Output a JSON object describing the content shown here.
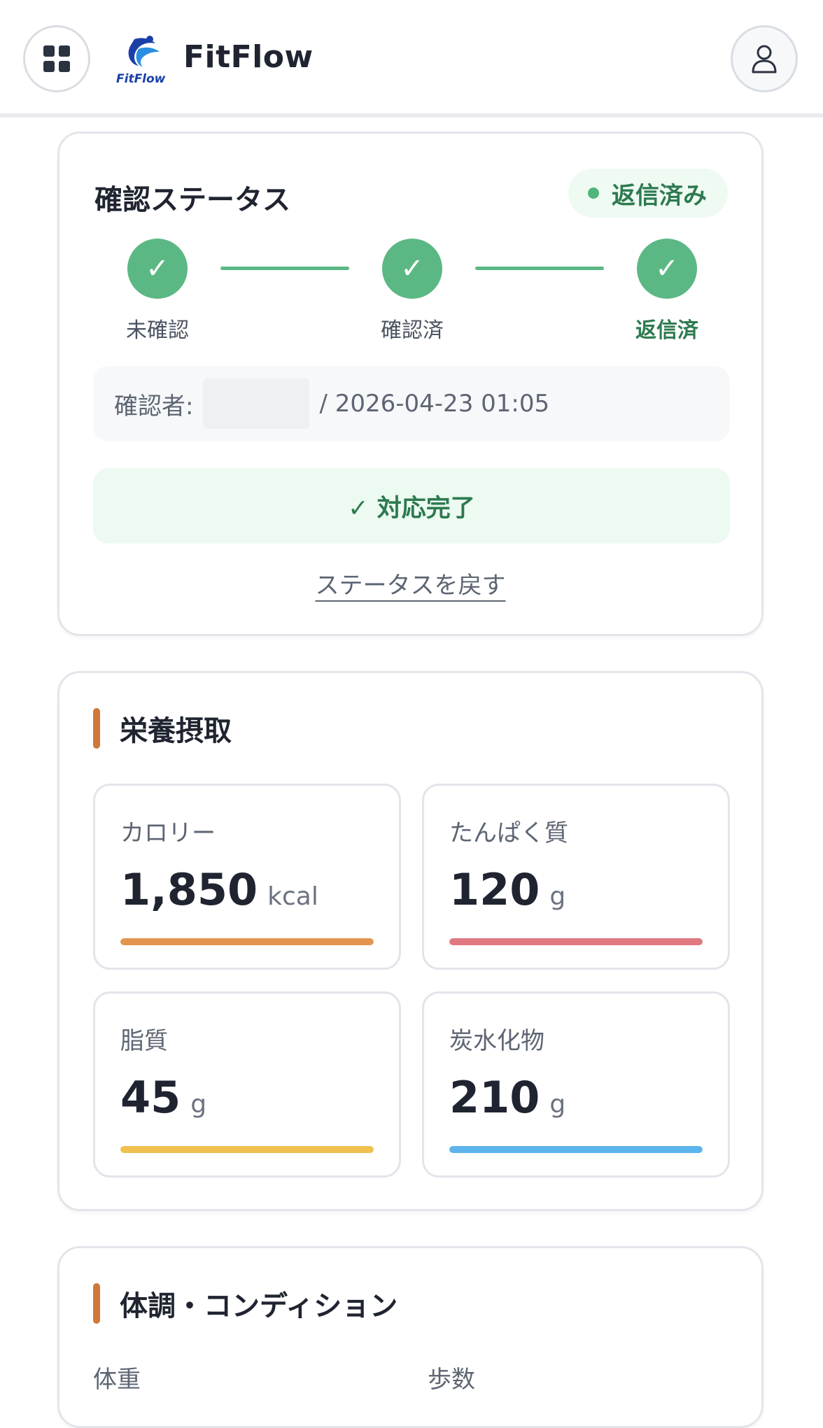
{
  "header": {
    "app_title": "FitFlow",
    "logo_text": "FitFlow"
  },
  "status": {
    "title": "確認ステータス",
    "badge": "返信済み",
    "steps": [
      {
        "label": "未確認",
        "mark": "✓"
      },
      {
        "label": "確認済",
        "mark": "✓"
      },
      {
        "label": "返信済",
        "mark": "✓"
      }
    ],
    "confirmer_label": "確認者:",
    "confirmer_time": "/ 2026-04-23 01:05",
    "done_button": "✓ 対応完了",
    "revert_link": "ステータスを戻す",
    "colors": {
      "accent": "#5bb884",
      "accent_dark": "#2d7a4f"
    }
  },
  "nutrition": {
    "title": "栄養摂取",
    "metrics": [
      {
        "label": "カロリー",
        "value": "1,850",
        "unit": "kcal",
        "fill": 1.0,
        "color": "#e39550"
      },
      {
        "label": "たんぱく質",
        "value": "120",
        "unit": "g",
        "fill": 1.0,
        "color": "#e07880"
      },
      {
        "label": "脂質",
        "value": "45",
        "unit": "g",
        "fill": 1.0,
        "color": "#f0c050"
      },
      {
        "label": "炭水化物",
        "value": "210",
        "unit": "g",
        "fill": 1.0,
        "color": "#5cb4ec"
      }
    ]
  },
  "condition": {
    "title": "体調・コンディション",
    "labels": [
      "体重",
      "歩数"
    ]
  }
}
